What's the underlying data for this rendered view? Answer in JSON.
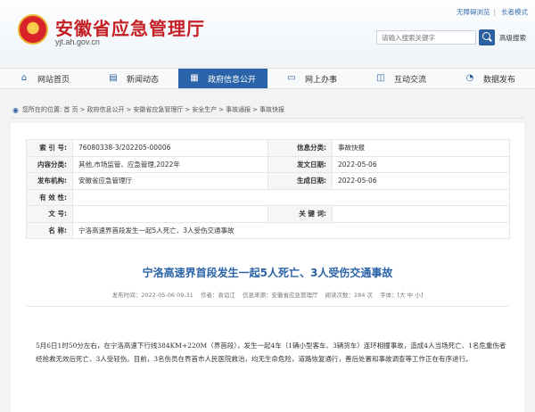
{
  "header": {
    "site_title": "安徽省应急管理厅",
    "site_domain": "yjt.ah.gov.cn",
    "top_links": [
      "无障碍浏览",
      "长者模式"
    ],
    "search_placeholder": "请输入搜索关键字",
    "advanced_search": "高级搜索"
  },
  "nav": {
    "items": [
      {
        "label": "网站首页",
        "icon": "home-icon"
      },
      {
        "label": "新闻动态",
        "icon": "news-icon"
      },
      {
        "label": "政府信息公开",
        "icon": "document-icon",
        "active": true
      },
      {
        "label": "网上办事",
        "icon": "monitor-icon"
      },
      {
        "label": "互动交流",
        "icon": "chat-icon"
      },
      {
        "label": "数据发布",
        "icon": "chart-icon"
      }
    ]
  },
  "breadcrumb": {
    "prefix": "您所在的位置:",
    "items": [
      "首 页",
      "政府信息公开",
      "安徽省应急管理厅",
      "安全生产",
      "事故通报",
      "事故快报"
    ]
  },
  "info": {
    "index_label": "索 引 号:",
    "index_value": "76080338-3/202205-00006",
    "category_label": "信息分类:",
    "category_value": "事故快报",
    "content_class_label": "内容分类:",
    "content_class_value": "其他,市场监管、应急管理,2022年",
    "issue_date_label": "发文日期:",
    "issue_date_value": "2022-05-06",
    "publisher_label": "发布机构:",
    "publisher_value": "安徽省应急管理厅",
    "created_date_label": "生成日期:",
    "created_date_value": "2022-05-06",
    "validity_label": "有 效 性:",
    "validity_value": "",
    "doc_no_label": "文 号:",
    "doc_no_value": "",
    "keywords_label": "关 键 词:",
    "keywords_value": "",
    "name_label": "名 称:",
    "name_value": "宁洛高速界首段发生一起5人死亡、3人受伤交通事故"
  },
  "article": {
    "title": "宁洛高速界首段发生一起5人死亡、3人受伤交通事故",
    "meta_date": "发布时间：2022-05-06 09:31",
    "meta_author": "作者：袁诣江",
    "meta_source": "信息来源：安徽省应急管理厅",
    "meta_views": "阅读次数：284 次",
    "meta_font": "字体：[大 中 小]",
    "body": "5月6日1时50分左右，在宁洛高速下行线384KM+220M（界首段），发生一起4车（1辆小型客车、3辆货车）连环相撞事故，造成4人当场死亡、1名危重伤者经抢救无效后死亡、3人受轻伤。目前，3名伤员在界首市人民医院救治，均无生命危险，道路恢复通行，善后处置和事故调查等工作正在有序进行。"
  }
}
